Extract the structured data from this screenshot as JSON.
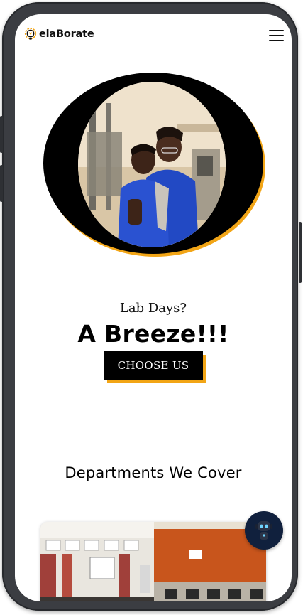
{
  "header": {
    "logo_text": "elaBorate",
    "logo_icon": "lightbulb-gear-icon",
    "menu_icon": "hamburger-menu-icon"
  },
  "hero": {
    "photo_description_icon": "students-hugging-photo",
    "kicker": "Lab Days?",
    "headline": "A Breeze!!!",
    "cta_label": "CHOOSE US"
  },
  "departments": {
    "title": "Departments We Cover",
    "card_image": "lab-classroom-photo"
  },
  "chat": {
    "icon": "chatbot-robot-icon"
  },
  "colors": {
    "accent": "#f2a516",
    "primary": "#000000",
    "frame": "#3b3d42",
    "chat_bg": "#10203d"
  }
}
